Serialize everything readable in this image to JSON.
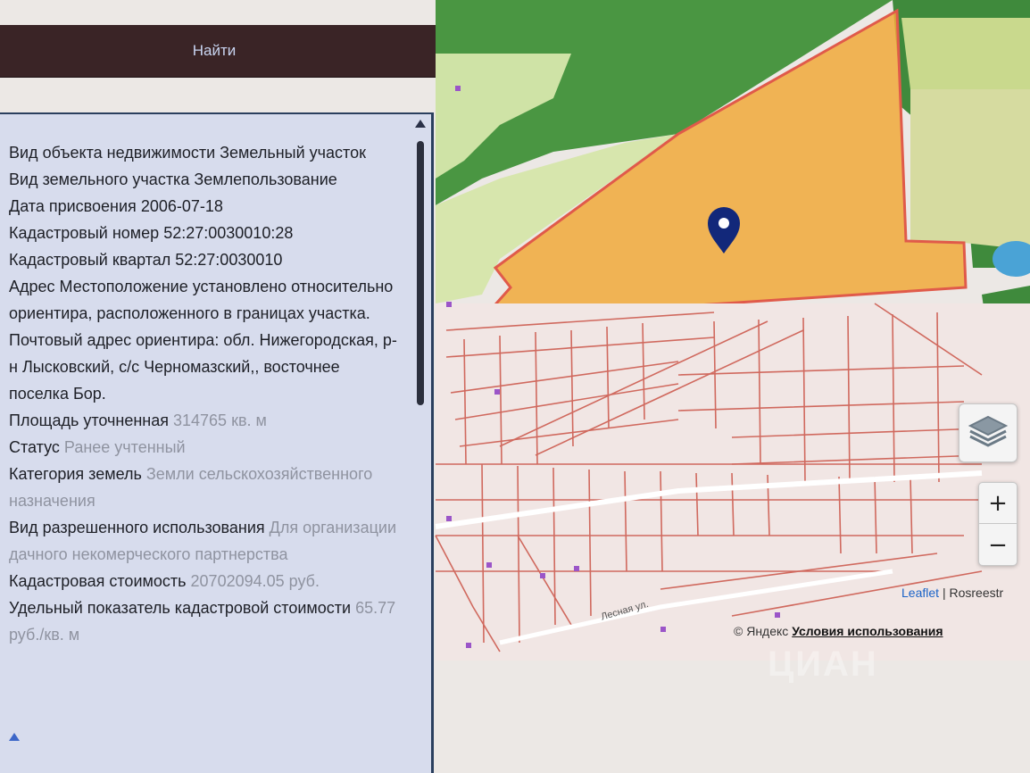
{
  "search": {
    "button_label": "Найти"
  },
  "info": {
    "rows": [
      {
        "label": "Вид объекта недвижимости",
        "value": "Земельный участок",
        "muted": false
      },
      {
        "label": "Вид земельного участка",
        "value": "Землепользование",
        "muted": false
      },
      {
        "label": "Дата присвоения",
        "value": "2006-07-18",
        "muted": false
      },
      {
        "label": "Кадастровый номер",
        "value": "52:27:0030010:28",
        "muted": false
      },
      {
        "label": "Кадастровый квартал",
        "value": "52:27:0030010",
        "muted": false
      },
      {
        "label": "Адрес",
        "value": "Местоположение установлено относительно ориентира, расположенного в границах участка. Почтовый адрес ориентира: обл. Нижегородская, р-н Лысковский, с/с Черномазский,, восточнее поселка Бор.",
        "muted": false
      },
      {
        "label": "Площадь уточненная",
        "value": "314765 кв. м",
        "muted": true
      },
      {
        "label": "Статус",
        "value": "Ранее учтенный",
        "muted": true
      },
      {
        "label": "Категория земель",
        "value": "Земли сельскохозяйственного назначения",
        "muted": true
      },
      {
        "label": "Вид разрешенного использования",
        "value": "Для организации дачного некомерческого партнерства",
        "muted": true
      },
      {
        "label": "Кадастровая стоимость",
        "value": "20702094.05 руб.",
        "muted": true
      },
      {
        "label": "Удельный показатель кадастровой стоимости",
        "value": "65.77 руб./кв. м",
        "muted": true
      }
    ]
  },
  "map": {
    "zoom_in": "+",
    "zoom_out": "−",
    "layers_icon": "layers-icon",
    "marker_icon": "map-marker-icon",
    "street_label": "Лесная ул.",
    "attribution_leaflet": "Leaflet",
    "attribution_separator": "|",
    "attribution_rosreestr": "Rosreestr",
    "yandex_prefix": "© Яндекс",
    "yandex_terms": "Условия использования",
    "watermark": "ЦИАН",
    "colors": {
      "parcel_fill": "#f1a93b",
      "parcel_border": "#e05a4a",
      "forest": "#3f8a3c",
      "meadow": "#cfe3a6",
      "plots_border": "#d0695e",
      "panel_bg": "#d7dced"
    }
  }
}
